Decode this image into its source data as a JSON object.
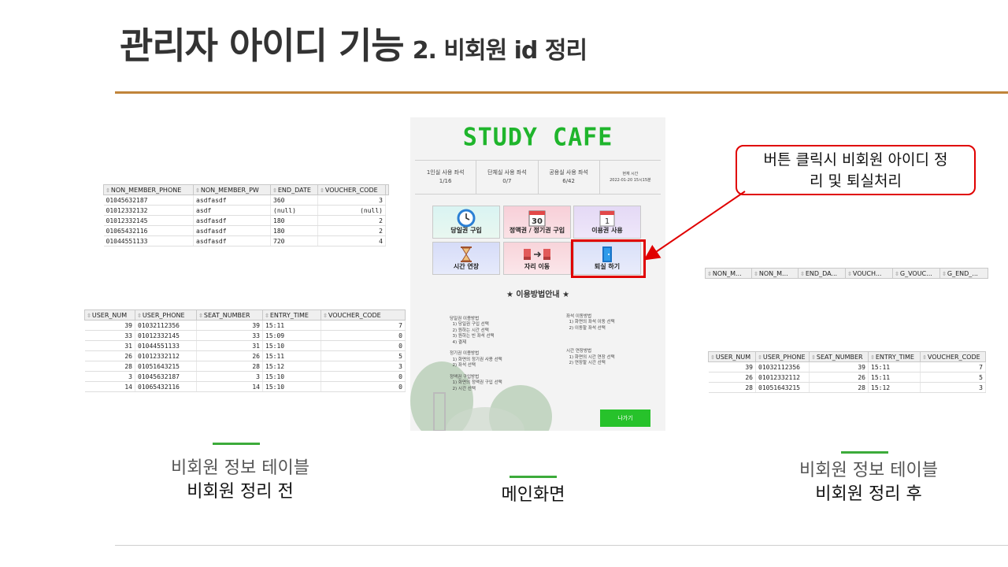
{
  "slide": {
    "title_main": "관리자 아이디 기능",
    "title_sub": "2. 비회원 id 정리"
  },
  "non_member_table": {
    "headers": [
      "NON_MEMBER_PHONE",
      "NON_MEMBER_PW",
      "END_DATE",
      "VOUCHER_CODE",
      ""
    ],
    "rows": [
      [
        "01045632187",
        "asdfasdf",
        "360",
        "3"
      ],
      [
        "01012332132",
        "asdf",
        "(null)",
        "(null)"
      ],
      [
        "01012332145",
        "asdfasdf",
        "180",
        "2"
      ],
      [
        "01065432116",
        "asdfasdf",
        "180",
        "2"
      ],
      [
        "01044551133",
        "asdfasdf",
        "720",
        "4"
      ]
    ]
  },
  "user_table_before": {
    "headers": [
      "USER_NUM",
      "USER_PHONE",
      "SEAT_NUMBER",
      "ENTRY_TIME",
      "VOUCHER_CODE"
    ],
    "rows": [
      [
        "39",
        "01032112356",
        "39",
        "15:11",
        "7"
      ],
      [
        "33",
        "01012332145",
        "33",
        "15:09",
        "0"
      ],
      [
        "31",
        "01044551133",
        "31",
        "15:10",
        "0"
      ],
      [
        "26",
        "01012332112",
        "26",
        "15:11",
        "5"
      ],
      [
        "28",
        "01051643215",
        "28",
        "15:12",
        "3"
      ],
      [
        "3",
        "01045632187",
        "3",
        "15:10",
        "0"
      ],
      [
        "14",
        "01065432116",
        "14",
        "15:10",
        "0"
      ]
    ]
  },
  "non_member_table_after": {
    "headers": [
      "NON_M...",
      "NON_M...",
      "END_DA...",
      "VOUCH...",
      "G_VOUC...",
      "G_END_..."
    ]
  },
  "user_table_after": {
    "headers": [
      "USER_NUM",
      "USER_PHONE",
      "SEAT_NUMBER",
      "ENTRY_TIME",
      "VOUCHER_CODE"
    ],
    "rows": [
      [
        "39",
        "01032112356",
        "39",
        "15:11",
        "7"
      ],
      [
        "26",
        "01012332112",
        "26",
        "15:11",
        "5"
      ],
      [
        "28",
        "01051643215",
        "28",
        "15:12",
        "3"
      ]
    ]
  },
  "app": {
    "title": "STUDY CAFE",
    "stats": [
      {
        "label": "1인실 사용 좌석",
        "value": "1/16"
      },
      {
        "label": "단체실 사용 좌석",
        "value": "0/7"
      },
      {
        "label": "공용실 사용 좌석",
        "value": "6/42"
      },
      {
        "label": "현재 시간",
        "value": "2022-01-20 15시15분"
      }
    ],
    "tiles": [
      {
        "label": "당일권 구입",
        "icon": "clock-icon"
      },
      {
        "label": "정액권 / 정기권 구입",
        "icon": "calendar-30-icon",
        "num": "30"
      },
      {
        "label": "이용권 사용",
        "icon": "calendar-1-icon",
        "num": "1"
      },
      {
        "label": "시간 연장",
        "icon": "hourglass-icon"
      },
      {
        "label": "자리 이동",
        "icon": "seat-move-icon"
      },
      {
        "label": "퇴실 하기",
        "icon": "door-exit-icon"
      }
    ],
    "guide_title": "★ 이용방법안내 ★",
    "guide_left": "당일권 이용방법\n  1) 당일권 구입 선택\n  2) 원하는 시간 선택\n  3) 원하는 빈 좌석 선택\n  4) 결제\n\n정기권 이용방법\n  1) 화면의 정기권 사용 선택\n  2) 좌석 선택\n\n정액권 구입방법\n  1) 화면의 정액권 구입 선택\n  2) 시간 선택",
    "guide_right": "좌석 이동방법\n  1) 화면의 좌석 이동 선택\n  2) 이동할 좌석 선택\n\n\n\n시간 연장방법\n  1) 화면의 시간 연장 선택\n  2) 연장할 시간 선택",
    "exit_label": "나가기"
  },
  "callout": {
    "line1": "버튼 클릭시 비회원 아이디 정",
    "line2": "리 및 퇴실처리"
  },
  "captions": {
    "left_l1": "비회원 정보 테이블",
    "left_l2": "비회원 정리 전",
    "center": "메인화면",
    "right_l1": "비회원 정보 테이블",
    "right_l2": "비회원 정리 후"
  },
  "colors": {
    "accent_rule": "#c0843a",
    "app_title": "#1fb52c",
    "highlight": "#e00000",
    "caption_bar": "#3cab3a"
  }
}
